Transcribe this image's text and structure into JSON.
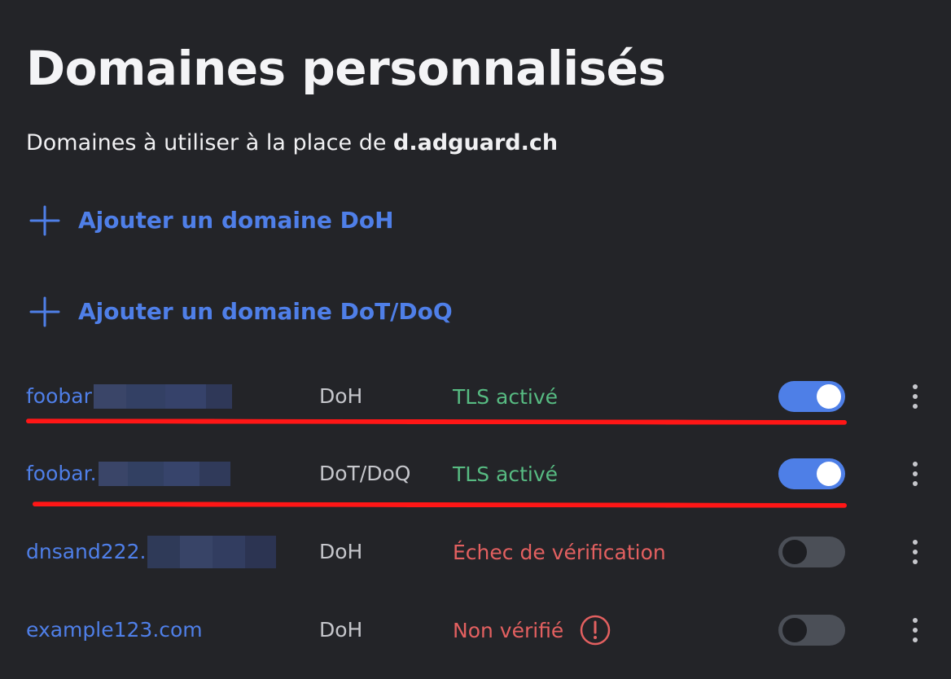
{
  "header": {
    "title": "Domaines personnalisés",
    "subtitle_prefix": "Domaines à utiliser à la place de ",
    "subtitle_domain": "d.adguard.ch"
  },
  "actions": {
    "add_doh": "Ajouter un domaine DoH",
    "add_dot": "Ajouter un domaine DoT/DoQ"
  },
  "domains": [
    {
      "name": "foobar",
      "protocol": "DoH",
      "status": "TLS activé",
      "status_type": "ok",
      "enabled": true
    },
    {
      "name": "foobar.",
      "protocol": "DoT/DoQ",
      "status": "TLS activé",
      "status_type": "ok",
      "enabled": true
    },
    {
      "name": "dnsand222.",
      "protocol": "DoH",
      "status": "Échec de vérification",
      "status_type": "error",
      "enabled": false
    },
    {
      "name": "example123.com",
      "protocol": "DoH",
      "status": "Non vérifié",
      "status_type": "error",
      "enabled": false
    }
  ],
  "colors": {
    "background": "#232428",
    "accent": "#4f7fe8",
    "success": "#57bb82",
    "error": "#e36060",
    "highlight": "#ff1616"
  },
  "icons": {
    "add": "plus-icon",
    "more": "kebab-menu-icon",
    "warning": "exclamation-circle-icon"
  }
}
